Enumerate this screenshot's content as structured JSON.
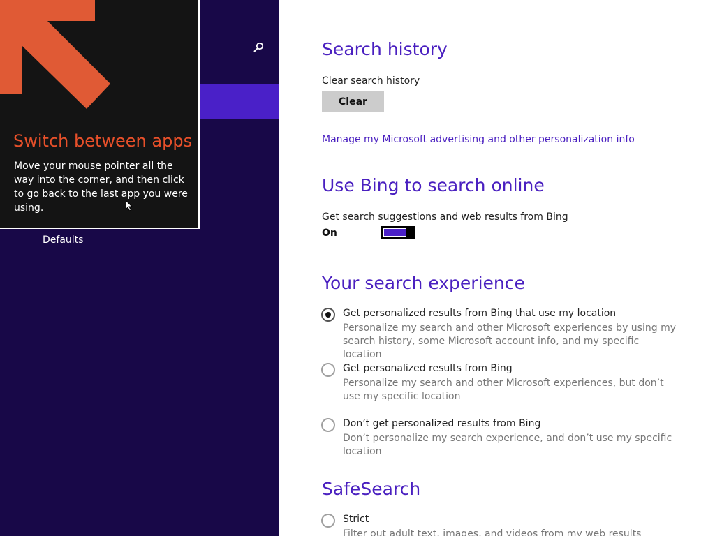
{
  "left_pane": {
    "search_icon": "search-icon",
    "nav_items": [
      "Defaults"
    ]
  },
  "tip": {
    "title": "Switch between apps",
    "body": "Move your mouse pointer all the way into the corner, and then click to go back to the last app you were using.",
    "arrow_color": "#e05a35"
  },
  "search_history": {
    "heading": "Search history",
    "clear_label": "Clear search history",
    "clear_button": "Clear",
    "manage_link": "Manage my Microsoft advertising and other personalization info"
  },
  "bing": {
    "heading": "Use Bing to search online",
    "label": "Get search suggestions and web results from Bing",
    "toggle_state": "On",
    "toggle_on": true
  },
  "experience": {
    "heading": "Your search experience",
    "options": [
      {
        "title": "Get personalized results from Bing that use my location",
        "desc": "Personalize my search and other Microsoft experiences by using my search history, some Microsoft account info, and my specific location",
        "checked": true
      },
      {
        "title": "Get personalized results from Bing",
        "desc": "Personalize my search and other Microsoft experiences, but don’t use my specific location",
        "checked": false
      },
      {
        "title": "Don’t get personalized results from Bing",
        "desc": "Don’t personalize my search experience, and don’t use my specific location",
        "checked": false
      }
    ]
  },
  "safesearch": {
    "heading": "SafeSearch",
    "options": [
      {
        "title": "Strict",
        "desc": "Filter out adult text, images, and videos from my web results",
        "checked": false
      }
    ]
  },
  "colors": {
    "accent": "#4a20c0",
    "nav_background": "#180848",
    "tip_title": "#e8502a"
  }
}
